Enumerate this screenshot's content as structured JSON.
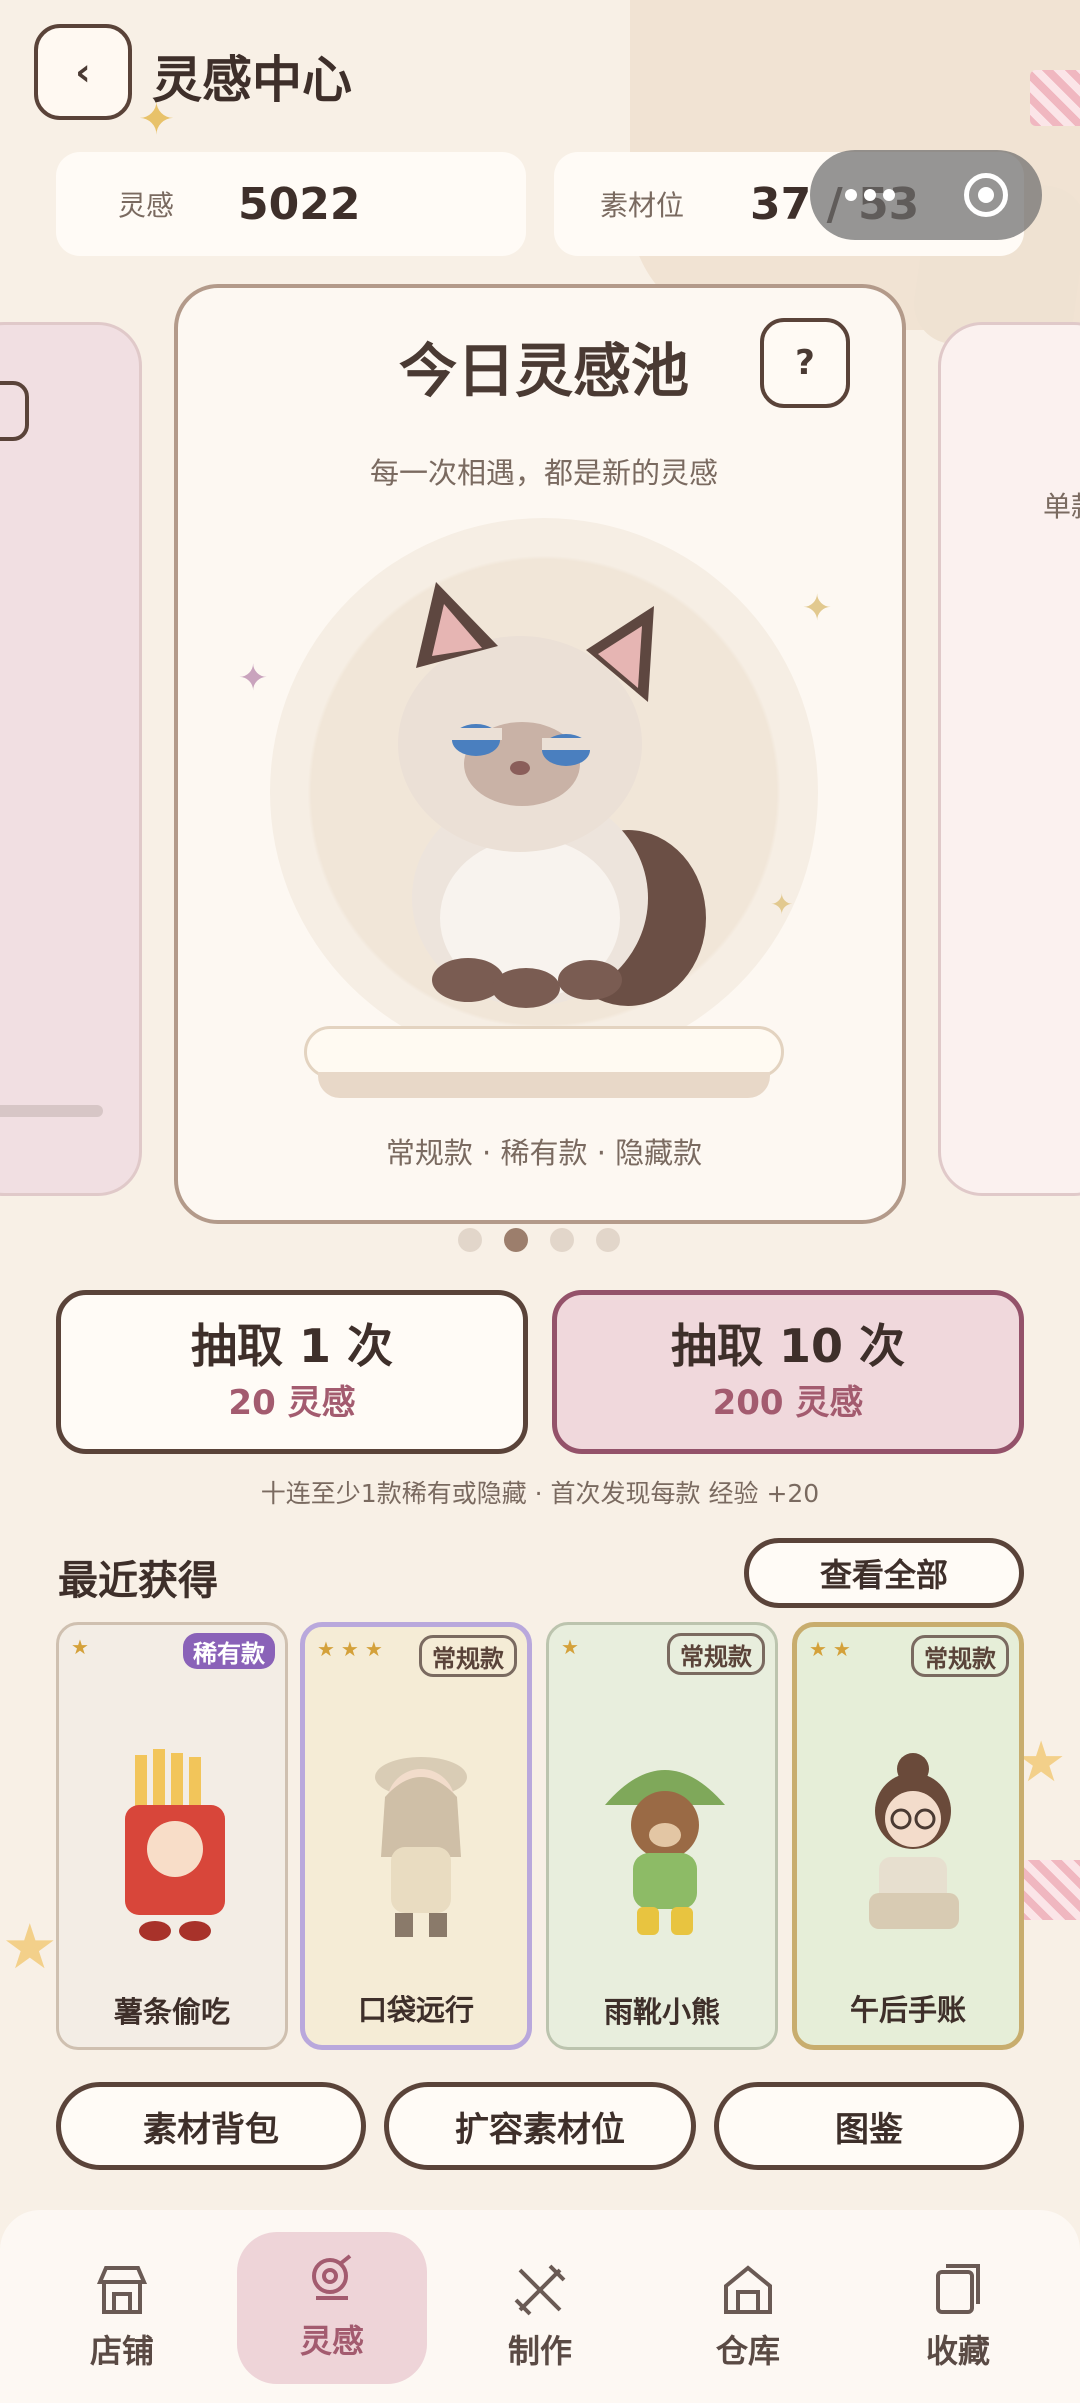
{
  "header": {
    "title": "灵感中心"
  },
  "stats": {
    "inspiration": {
      "label": "灵感",
      "value": "5022"
    },
    "slots": {
      "label": "素材位",
      "value": "37 / 53"
    }
  },
  "carousel": {
    "card": {
      "title": "今日灵感池",
      "help": "?",
      "subtitle": "每一次相遇，都是新的灵感",
      "types": "常规款 · 稀有款 · 隐藏款"
    },
    "right_peek_text": "单款",
    "page_count": 4,
    "active_page": 2
  },
  "draw": {
    "once": {
      "label": "抽取 1 次",
      "cost": "20 灵感"
    },
    "ten": {
      "label": "抽取 10 次",
      "cost": "200 灵感"
    },
    "hint": "十连至少1款稀有或隐藏 · 首次发现每款 经验 +20"
  },
  "recent": {
    "title": "最近获得",
    "view_all": "查看全部",
    "items": [
      {
        "name": "薯条偷吃",
        "badge": "稀有款",
        "stars": "★"
      },
      {
        "name": "口袋远行",
        "badge": "常规款",
        "stars": "★★★"
      },
      {
        "name": "雨靴小熊",
        "badge": "常规款",
        "stars": "★"
      },
      {
        "name": "午后手账",
        "badge": "常规款",
        "stars": "★★"
      }
    ]
  },
  "tools": {
    "bag": "素材背包",
    "expand": "扩容素材位",
    "atlas": "图鉴"
  },
  "tabs": [
    {
      "label": "店铺",
      "icon": "shop-icon"
    },
    {
      "label": "灵感",
      "icon": "inspiration-icon"
    },
    {
      "label": "制作",
      "icon": "craft-tools-icon"
    },
    {
      "label": "仓库",
      "icon": "warehouse-icon"
    },
    {
      "label": "收藏",
      "icon": "collection-icon"
    }
  ],
  "colors": {
    "accent": "#a35b6f",
    "border": "#5a4339",
    "background": "#f8f0e6",
    "rare_badge": "#8a62b8"
  }
}
